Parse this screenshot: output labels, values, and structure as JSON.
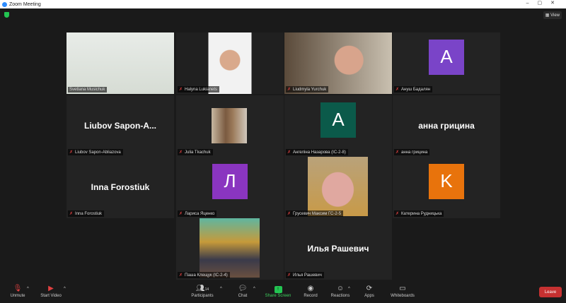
{
  "window": {
    "title": "Zoom Meeting",
    "view_label": "View"
  },
  "tiles": [
    {
      "name": "Svetlana Musichuk",
      "type": "video"
    },
    {
      "name": "Halyna Lukianets",
      "type": "video"
    },
    {
      "name": "Liudmyla Yurchuk",
      "type": "video"
    },
    {
      "name": "Ануш Бадалян",
      "type": "avatar",
      "initial": "A",
      "color": "#7a44c8"
    },
    {
      "name": "Liubov Sapon-Abliazova",
      "type": "name",
      "display": "Liubov  Sapon-A..."
    },
    {
      "name": "Julia Tkachuk",
      "type": "photo"
    },
    {
      "name": "Ангеліна Назарова (ІС-2-8)",
      "type": "avatar",
      "initial": "A",
      "color": "#0b5a4a"
    },
    {
      "name": "анна грицина",
      "type": "name",
      "display": "анна грицина"
    },
    {
      "name": "Inna Forostiuk",
      "type": "name",
      "display": "Inna Forostiuk"
    },
    {
      "name": "Лариса Яценко",
      "type": "avatar",
      "initial": "Л",
      "color": "#8a35c0"
    },
    {
      "name": "Грусевич Максим ГС-2-5",
      "type": "photo"
    },
    {
      "name": "Катерина Рудницька",
      "type": "avatar",
      "initial": "K",
      "color": "#e8730c"
    },
    {
      "name": "Паша Клещук (ІС-2-4)",
      "type": "photo"
    },
    {
      "name": "Илья Рашевич",
      "type": "name",
      "display": "Илья Рашевич"
    }
  ],
  "toolbar": {
    "unmute": "Unmute",
    "start_video": "Start Video",
    "participants": "Participants",
    "participants_count": "14",
    "chat": "Chat",
    "share_screen": "Share Screen",
    "record": "Record",
    "reactions": "Reactions",
    "apps": "Apps",
    "whiteboards": "Whiteboards",
    "leave": "Leave"
  }
}
